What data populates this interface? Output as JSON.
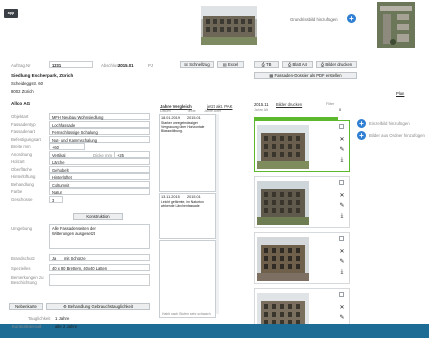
{
  "header": {
    "grundriss_label": "Grundrissbild hinzufügen",
    "auftrag_label": "Auftrag.Nr",
    "auftrag_value": "1231",
    "abschluss_label": "Abschluss",
    "abschluss_value": "2015.01",
    "pj_label": "PJ",
    "btn_schnellzug": "Schnellzug",
    "btn_excel": "Excel",
    "btn_tb": "TB",
    "btn_blatt": "Blatt A4",
    "btn_bilder_drucken": "Bilder drucken",
    "btn_fassaden_dossier": "Fassaden-Dossier als PDF erstellen",
    "plan_link": "Plan"
  },
  "address": {
    "name": "Siedlung Escherpark, Zürich",
    "street": "Scheideggstr. 60",
    "city": "8002 Zürich",
    "company": "Allco AG"
  },
  "form": {
    "rows": [
      {
        "label": "Objektart",
        "value": "MFH Neubau Wohnsiedlung"
      },
      {
        "label": "Fassadentyp",
        "value": "Lochfassade"
      },
      {
        "label": "Fassadenart",
        "value": "Fernschlüssige Schalung"
      },
      {
        "label": "Befestigungsart",
        "value": "Nut- und Kammschalung"
      },
      {
        "label": "Breite mm",
        "value": "+60"
      },
      {
        "label": "Anordnung",
        "value": "Vertikal"
      },
      {
        "label": "Holzart",
        "value": "Lärche"
      },
      {
        "label": "Oberfläche",
        "value": "Gehobelt"
      },
      {
        "label": "Hinterlüftung",
        "value": "Hinterlüftet"
      },
      {
        "label": "Behandlung",
        "value": "Coltumnit"
      },
      {
        "label": "Farbe",
        "value": "Natur"
      },
      {
        "label": "Geschosse",
        "value": "3"
      }
    ],
    "dicke_label": "Dicke mm",
    "dicke_value": "+25",
    "btn_konstruktion": "Konstruktion",
    "umgebung_label": "Umgebung",
    "umgebung_value": "Alle Fassadenseiten der Witterungen ausgesetzt",
    "brandschutz_label": "Brandschutz",
    "brandschutz_value": "Ja",
    "brandschutz_extra": "mit Schürze",
    "spezielles_label": "Spezielles",
    "spezielles_value": "40 x 80 Brettern, 40x40 Latten",
    "bemerkungen_label": "Bemerkungen zu Beschichtung",
    "btn_nebenkarte": "Nebenkarte",
    "btn_behandlung": "Behandlung Gebrauchstauglichkeit",
    "tauglichkeit_label": "Tauglichkeit",
    "tauglichkeit_value": "1 Jahre",
    "kontrollintervall_label": "Kontrollintervall",
    "kontrollintervall_value": "alle 2 Jahre"
  },
  "compare": {
    "title": "Jahre Vergleich",
    "datum": "Datum",
    "link": "jetzt akt. PAK",
    "texte": "Texte",
    "jahre": "Jahre Alter",
    "entry1_date": "18.01.2019",
    "entry1_date2": "2015.01",
    "entry1_text": "Starker unregelmässiger Vergrauung über Horizontale Blasswölbung.",
    "entry2_date": "13.11.2015",
    "entry2_date2": "2015.01",
    "entry2_text": "Leicht gefärmte, im Naturton wirkende Lärchenfassade",
    "footer_text": "Habit nach Stufen sehr schwach"
  },
  "photos": {
    "header_date": "2015.11",
    "header_link": "Bilder drucken",
    "header_jahr": "Jahre Alt",
    "filter_label": "Filter",
    "filter_value": "0",
    "btn_einzelbild": "Einzelbild hinzufügen",
    "btn_ordner": "Bilder aus Ordner hinzufügen"
  },
  "colors": {
    "accent_blue": "#2f7fd3",
    "selected_green": "#5cb82c",
    "bottom_bar": "#1d6c96"
  }
}
